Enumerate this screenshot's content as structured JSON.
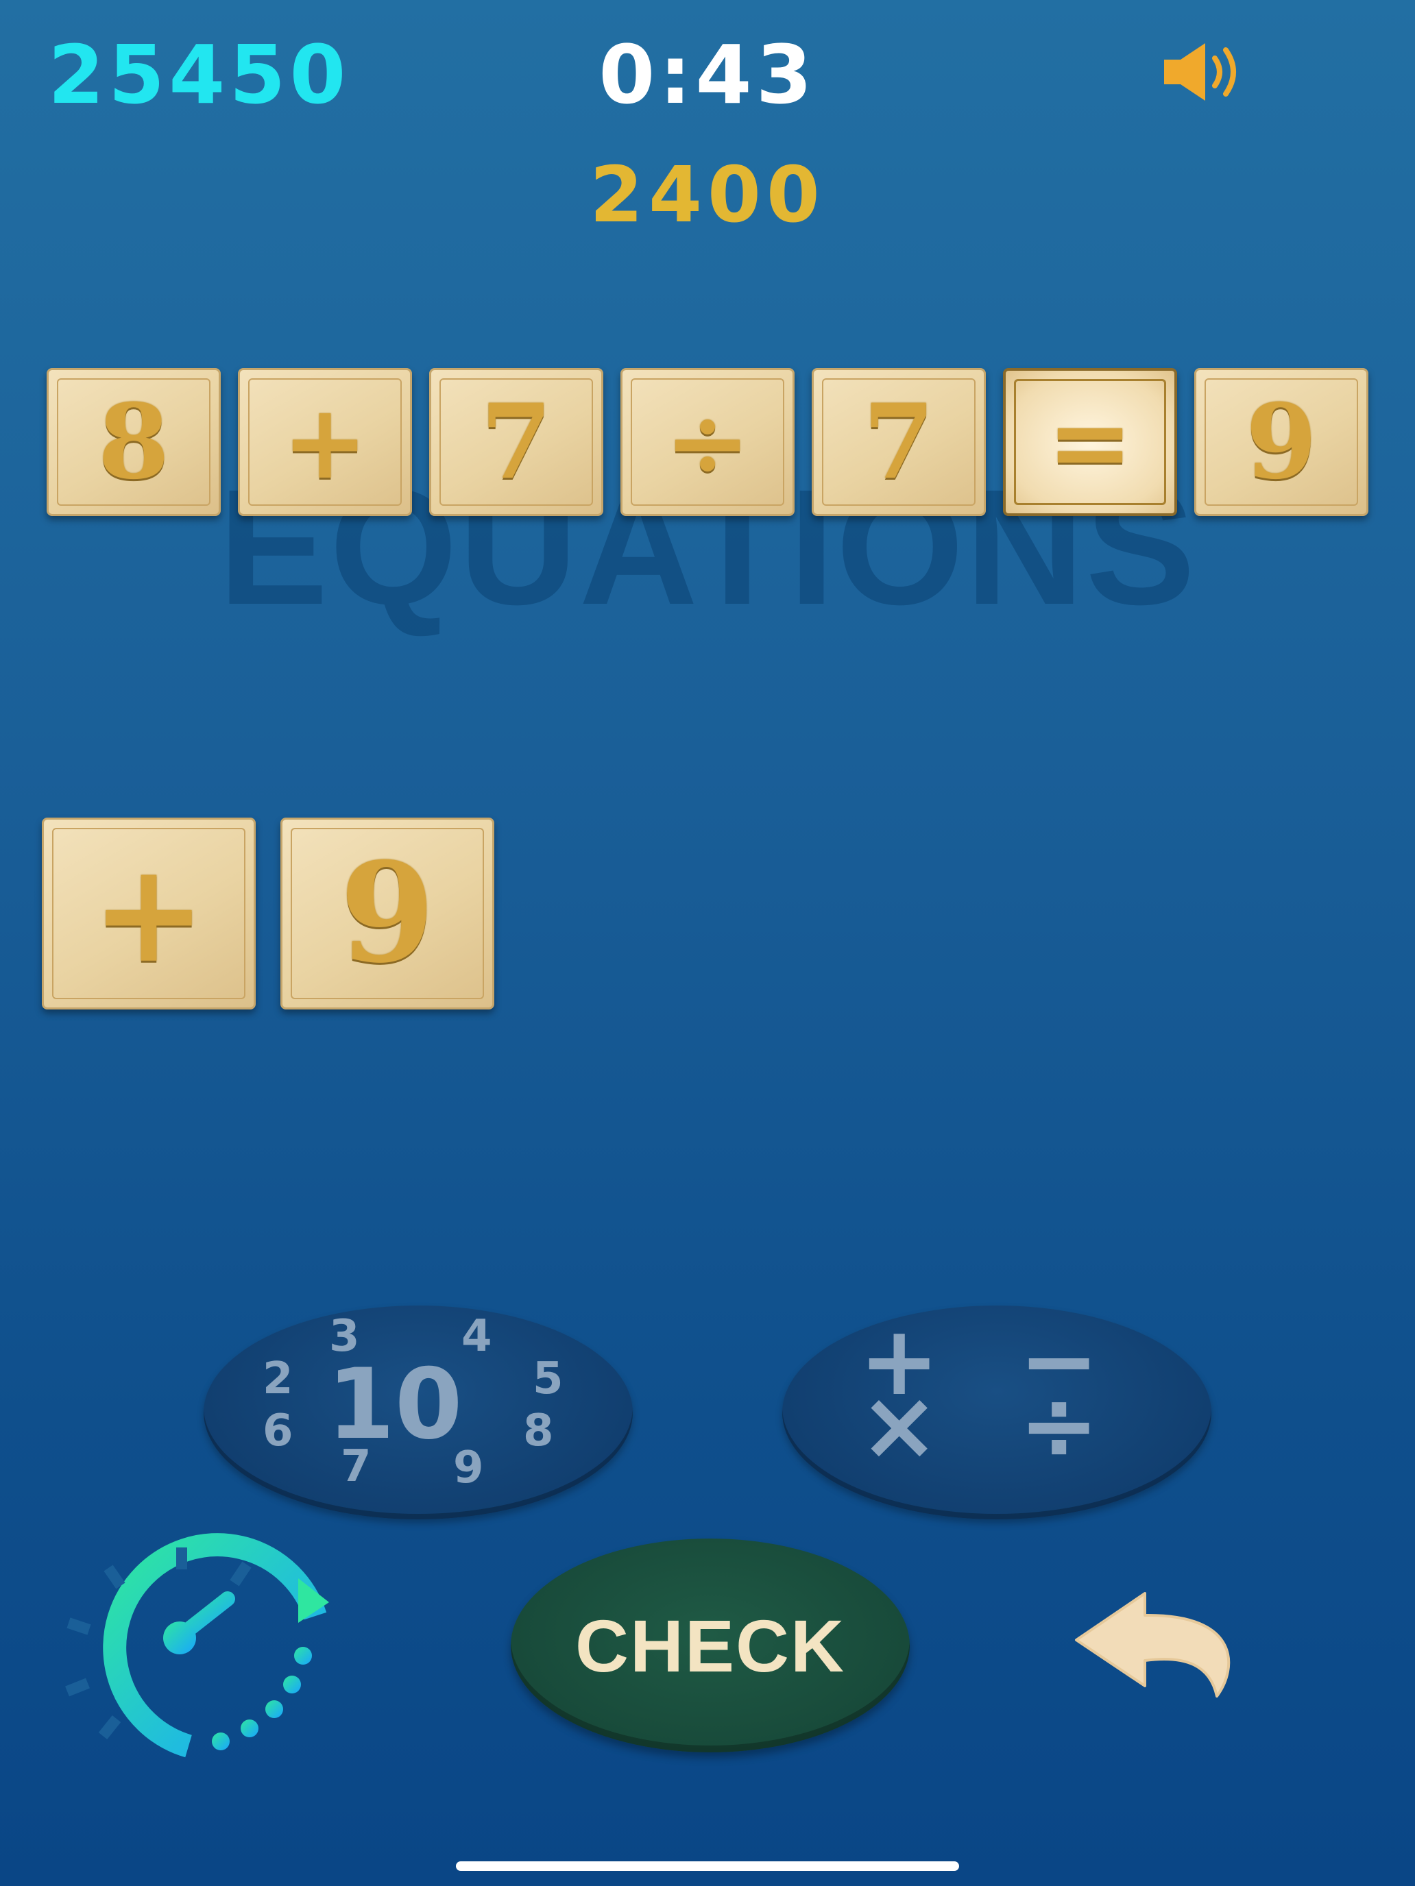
{
  "hud": {
    "score": "25450",
    "timer": "0:43",
    "round_points": "2400"
  },
  "watermark": "EQUATIONS",
  "equation_row": [
    {
      "value": "8",
      "kind": "number"
    },
    {
      "value": "+",
      "kind": "operator"
    },
    {
      "value": "7",
      "kind": "number"
    },
    {
      "value": "÷",
      "kind": "operator"
    },
    {
      "value": "7",
      "kind": "number"
    },
    {
      "value": "=",
      "kind": "equals"
    },
    {
      "value": "9",
      "kind": "number"
    }
  ],
  "tray_tiles": [
    {
      "value": "+",
      "kind": "operator"
    },
    {
      "value": "9",
      "kind": "number"
    }
  ],
  "numbers_button": {
    "center": "10",
    "ring": [
      "3",
      "4",
      "2",
      "5",
      "6",
      "8",
      "7",
      "9"
    ]
  },
  "operators_button": {
    "symbols": [
      "+",
      "−",
      "×",
      "÷"
    ]
  },
  "check_button": {
    "label": "CHECK"
  },
  "icons": {
    "sound": "speaker-icon",
    "speed": "speedometer-icon",
    "undo": "undo-arrow-icon"
  },
  "colors": {
    "score": "#22e6f0",
    "points": "#e3b733",
    "tile_face": "#ecd8aa",
    "tile_glyph": "#d6a43c",
    "check_button": "#1a4e3d",
    "undo": "#f2dcb8"
  }
}
